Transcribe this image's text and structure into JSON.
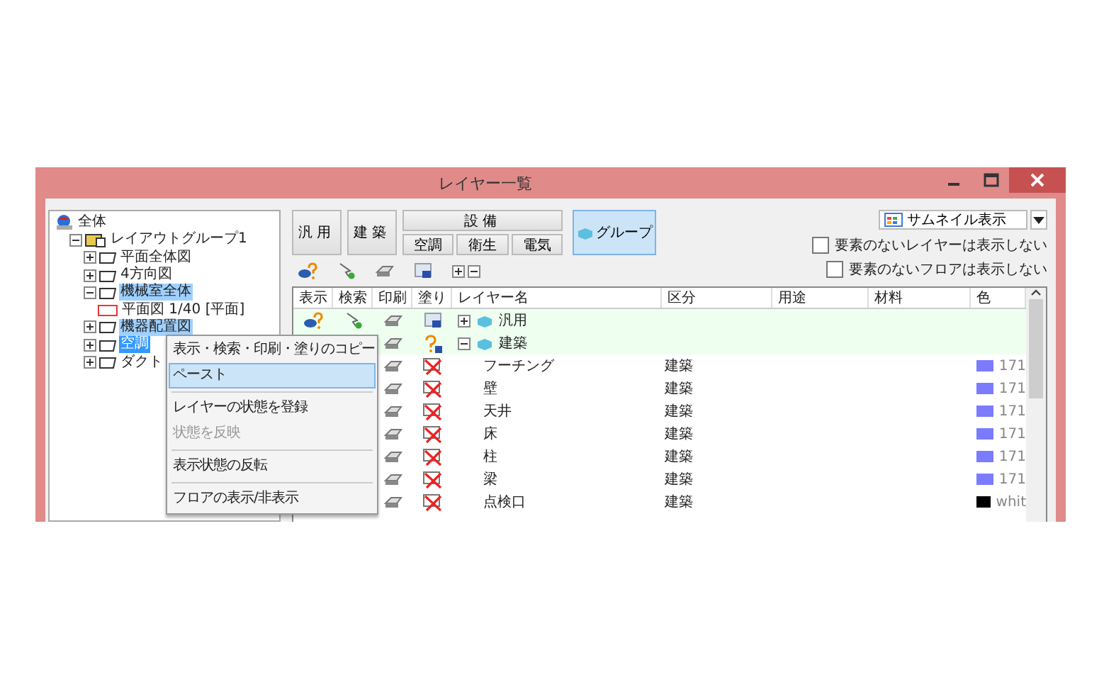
{
  "window": {
    "title": "レイヤー一覧"
  },
  "tree": [
    {
      "label": "全体",
      "kind": "root",
      "selected": false,
      "marked": false,
      "children": [
        {
          "label": "レイアウトグループ1",
          "kind": "group",
          "expanded": true,
          "selected": false,
          "marked": false,
          "children": [
            {
              "label": "平面全体図",
              "kind": "floor",
              "expanded": false,
              "selected": false,
              "marked": false
            },
            {
              "label": "4方向図",
              "kind": "floor",
              "expanded": false,
              "selected": false,
              "marked": false
            },
            {
              "label": "機械室全体",
              "kind": "floor",
              "expanded": true,
              "selected": false,
              "marked": true,
              "children": [
                {
                  "label": "平面図 1/40 [平面]",
                  "kind": "view",
                  "selected": false,
                  "marked": false
                }
              ]
            },
            {
              "label": "機器配置図",
              "kind": "floor",
              "expanded": false,
              "selected": false,
              "marked": true
            },
            {
              "label": "空調",
              "kind": "floor",
              "expanded": false,
              "selected": true,
              "marked": false
            },
            {
              "label": "ダクト",
              "kind": "floor",
              "expanded": false,
              "selected": false,
              "marked": false
            }
          ]
        }
      ]
    }
  ],
  "category_buttons": [
    {
      "kind": "single",
      "label": "汎用",
      "selected": false
    },
    {
      "kind": "single",
      "label": "建築",
      "selected": false
    },
    {
      "kind": "split",
      "label": "設備",
      "selected": false,
      "subs": [
        {
          "label": "空調",
          "selected": false
        },
        {
          "label": "衛生",
          "selected": false
        },
        {
          "label": "電気",
          "selected": false
        }
      ]
    },
    {
      "kind": "group",
      "label": "グループ",
      "selected": true
    }
  ],
  "view_dropdown": {
    "value": "サムネイル表示"
  },
  "options": [
    {
      "label": "要素のないレイヤーは表示しない",
      "checked": false
    },
    {
      "label": "要素のないフロアは表示しない",
      "checked": false
    }
  ],
  "table": {
    "columns": [
      "表示",
      "検索",
      "印刷",
      "塗り",
      "レイヤー名",
      "区分",
      "用途",
      "材料",
      "色"
    ],
    "rows": [
      {
        "kind": "group",
        "name": "汎用",
        "expanded": false,
        "display_mixed": true,
        "search_on": true,
        "filled": true,
        "fill_mixed": false
      },
      {
        "kind": "group",
        "name": "建築",
        "expanded": true,
        "fill_mixed": true
      },
      {
        "kind": "layer",
        "name": "フーチング",
        "category": "建築",
        "filled": false,
        "fill_mixed": false,
        "color": "#7b7bff",
        "color_label": "171"
      },
      {
        "kind": "layer",
        "name": "壁",
        "category": "建築",
        "filled": false,
        "fill_mixed": false,
        "color": "#7b7bff",
        "color_label": "171"
      },
      {
        "kind": "layer",
        "name": "天井",
        "category": "建築",
        "filled": false,
        "fill_mixed": false,
        "color": "#7b7bff",
        "color_label": "171"
      },
      {
        "kind": "layer",
        "name": "床",
        "category": "建築",
        "filled": false,
        "fill_mixed": false,
        "color": "#7b7bff",
        "color_label": "171"
      },
      {
        "kind": "layer",
        "name": "柱",
        "category": "建築",
        "filled": false,
        "fill_mixed": false,
        "color": "#7b7bff",
        "color_label": "171"
      },
      {
        "kind": "layer",
        "name": "梁",
        "category": "建築",
        "filled": false,
        "fill_mixed": false,
        "color": "#7b7bff",
        "color_label": "171"
      },
      {
        "kind": "layer",
        "name": "点検口",
        "category": "建築",
        "filled": false,
        "fill_mixed": false,
        "color": "#000000",
        "color_label": "whit"
      }
    ]
  },
  "context_menu": [
    {
      "kind": "item",
      "label": "表示・検索・印刷・塗りのコピー",
      "selected": false,
      "disabled": false
    },
    {
      "kind": "item",
      "label": "ペースト",
      "selected": true,
      "disabled": false
    },
    {
      "kind": "separator"
    },
    {
      "kind": "item",
      "label": "レイヤーの状態を登録",
      "selected": false,
      "disabled": false
    },
    {
      "kind": "item",
      "label": "状態を反映",
      "selected": false,
      "disabled": true
    },
    {
      "kind": "separator"
    },
    {
      "kind": "item",
      "label": "表示状態の反転",
      "selected": false,
      "disabled": false
    },
    {
      "kind": "separator"
    },
    {
      "kind": "item",
      "label": "フロアの表示/非表示",
      "selected": false,
      "disabled": false
    }
  ]
}
